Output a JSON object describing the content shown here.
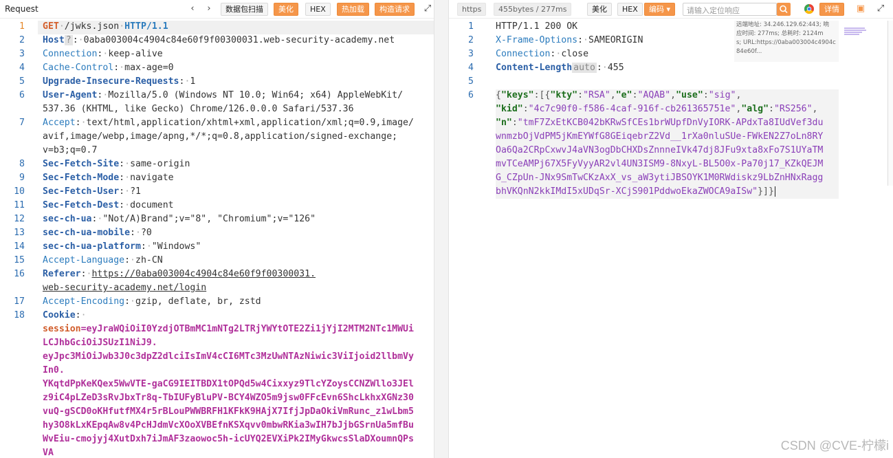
{
  "request_pane": {
    "title": "Request",
    "toolbar": {
      "packet_scan": "数据包扫描",
      "beautify": "美化",
      "hex": "HEX",
      "hot_load": "热加载",
      "construct_request": "构造请求"
    },
    "lines": [
      {
        "n": "1"
      },
      {
        "n": "2"
      },
      {
        "n": "3"
      },
      {
        "n": "4"
      },
      {
        "n": "5"
      },
      {
        "n": "6"
      },
      {
        "n": "7"
      },
      {
        "n": "8"
      },
      {
        "n": "9"
      },
      {
        "n": "10"
      },
      {
        "n": "11"
      },
      {
        "n": "12"
      },
      {
        "n": "13"
      },
      {
        "n": "14"
      },
      {
        "n": "15"
      },
      {
        "n": "16"
      },
      {
        "n": "17"
      },
      {
        "n": "18"
      }
    ],
    "text": {
      "method": "GET",
      "path": "/jwks.json",
      "proto": "HTTP/1.1",
      "host_k": "Host",
      "host_hint": "?",
      "host_v": "0aba003004c4904c84e60f9f00300031.web-security-academy.net",
      "conn_k": "Connection",
      "conn_v": "keep-alive",
      "cache_k": "Cache-Control",
      "cache_v": "max-age=0",
      "uir_k": "Upgrade-Insecure-Requests",
      "uir_v": "1",
      "ua_k": "User-Agent",
      "ua_v1": "Mozilla/5.0 (Windows NT 10.0; Win64; x64) AppleWebKit/",
      "ua_v2": "537.36 (KHTML, like Gecko) Chrome/126.0.0.0 Safari/537.36",
      "accept_k": "Accept",
      "accept_v1": "text/html,application/xhtml+xml,application/xml;q=0.9,image/",
      "accept_v2": "avif,image/webp,image/apng,*/*;q=0.8,application/signed-exchange;",
      "accept_v3": "v=b3;q=0.7",
      "sfs_k": "Sec-Fetch-Site",
      "sfs_v": "same-origin",
      "sfm_k": "Sec-Fetch-Mode",
      "sfm_v": "navigate",
      "sfu_k": "Sec-Fetch-User",
      "sfu_v": "?1",
      "sfd_k": "Sec-Fetch-Dest",
      "sfd_v": "document",
      "chua_k": "sec-ch-ua",
      "chua_v": "\"Not/A)Brand\";v=\"8\", \"Chromium\";v=\"126\"",
      "chm_k": "sec-ch-ua-mobile",
      "chm_v": "?0",
      "chp_k": "sec-ch-ua-platform",
      "chp_v": "\"Windows\"",
      "al_k": "Accept-Language",
      "al_v": "zh-CN",
      "ref_k": "Referer",
      "ref_v1": "https://0aba003004c4904c84e60f9f00300031.",
      "ref_v2": "web-security-academy.net/login",
      "ae_k": "Accept-Encoding",
      "ae_v": "gzip, deflate, br, zstd",
      "cookie_k": "Cookie",
      "cookie_name": "session",
      "cookie_l1": "eyJraWQiOiI0YzdjOTBmMC1mNTg2LTRjYWYtOTE2Zi1jYjI2MTM2NTc1MWUi",
      "cookie_l2": "LCJhbGciOiJSUzI1NiJ9.",
      "cookie_l3": "eyJpc3MiOiJwb3J0c3dpZ2dlciIsImV4cCI6MTc3MzUwNTAzNiwic3ViIjoid2llbmVy",
      "cookie_l4": "In0.",
      "cookie_l5": "YKqtdPpKeKQex5WwVTE-gaCG9IEITBDX1tOPQd5w4Cixxyz9TlcYZoysCCNZWllo3JEl",
      "cookie_l6": "z9iC4pLZeD3sRvJbxTr8q-TbIUFyBluPV-BCY4WZO5m9jsw0FFcEvn6ShcLkhxXGNz30",
      "cookie_l7": "vuQ-gSCD0oKHfutfMX4r5rBLouPWWBRFH1KFkK9HAjX7IfjJpDaOkiVmRunc_z1wLbm5",
      "cookie_l8": "hy3O8kLxKEpqAw8v4PcHJdmVcXOoXVBEfnKSXqvv0mbwRKia3wIH7bJjbGSrnUa5mfBu",
      "cookie_l9": "WvEiu-cmojyj4XutDxh7iJmAF3zaowoc5h-icUYQ2EVXiPk2IMyGkwcsSlaDXoumnQPs",
      "cookie_l10": "VA"
    }
  },
  "response_pane": {
    "toolbar": {
      "scheme": "https",
      "size": "455bytes / 277ms",
      "beautify": "美化",
      "hex": "HEX",
      "encoding": "编码",
      "search_placeholder": "请输入定位响应",
      "details": "详情"
    },
    "lines": [
      {
        "n": "1"
      },
      {
        "n": "2"
      },
      {
        "n": "3"
      },
      {
        "n": "4"
      },
      {
        "n": "5"
      },
      {
        "n": "6"
      }
    ],
    "text": {
      "status": "HTTP/1.1 200 OK",
      "xfo_k": "X-Frame-Options",
      "xfo_v": "SAMEORIGIN",
      "conn_k": "Connection",
      "conn_v": "close",
      "cl_k": "Content-Length",
      "cl_auto": "auto",
      "cl_v": "455",
      "j_keys": "\"keys\"",
      "j_kty": "\"kty\"",
      "j_kty_v": "\"RSA\"",
      "j_e": "\"e\"",
      "j_e_v": "\"AQAB\"",
      "j_use": "\"use\"",
      "j_use_v": "\"sig\"",
      "j_kid": "\"kid\"",
      "j_kid_v": "\"4c7c90f0-f586-4caf-916f-cb261365751e\"",
      "j_alg": "\"alg\"",
      "j_alg_v": "\"RS256\"",
      "j_n": "\"n\"",
      "j_n_v1": "\"tmF7ZxEtKCB042bKRwSfCEs1brWUpfDnVyIORK-APdxTa8IUdVef3du",
      "j_n_v2": "wnmzbOjVdPM5jKmEYWfG8GEiqebrZ2Vd__1rXa0nluSUe-FWkEN2Z7oLn8RY",
      "j_n_v3": "Oa6Qa2CRpCxwvJ4aVN3ogDbCHXDsZnnneIVk47dj8JFu9xta8xFo7S1UYaTM",
      "j_n_v4": "mvTCeAMPj67X5FyVyyAR2vl4UN3ISM9-8NxyL-BL5O0x-Pa70j17_KZkQEJM",
      "j_n_v5": "G_CZpUn-JNx9SmTwCKzAxX_vs_aW3ytiJBSOYK1M0RWdiskz9LbZnHNxRagg",
      "j_n_v6": "bhVKQnN2kkIMdI5xUDqSr-XCjS901PddwoEkaZWOCA9aISw\""
    },
    "remote_info": {
      "line1": "远端地址: 34.246.129.62:443; 响",
      "line2": "应时间: 277ms; 总耗时: 2124m",
      "line3": "s; URL:https://0aba003004c4904c",
      "line4": "84e60f..."
    }
  },
  "watermark": "CSDN @CVE-柠檬i",
  "colors": {
    "accent_orange": "#f5964a",
    "key_blue": "#2b7bbd",
    "cookie_purple": "#b0309a",
    "json_key_green": "#1c6e1c",
    "json_string_purple": "#8a3fb8"
  }
}
